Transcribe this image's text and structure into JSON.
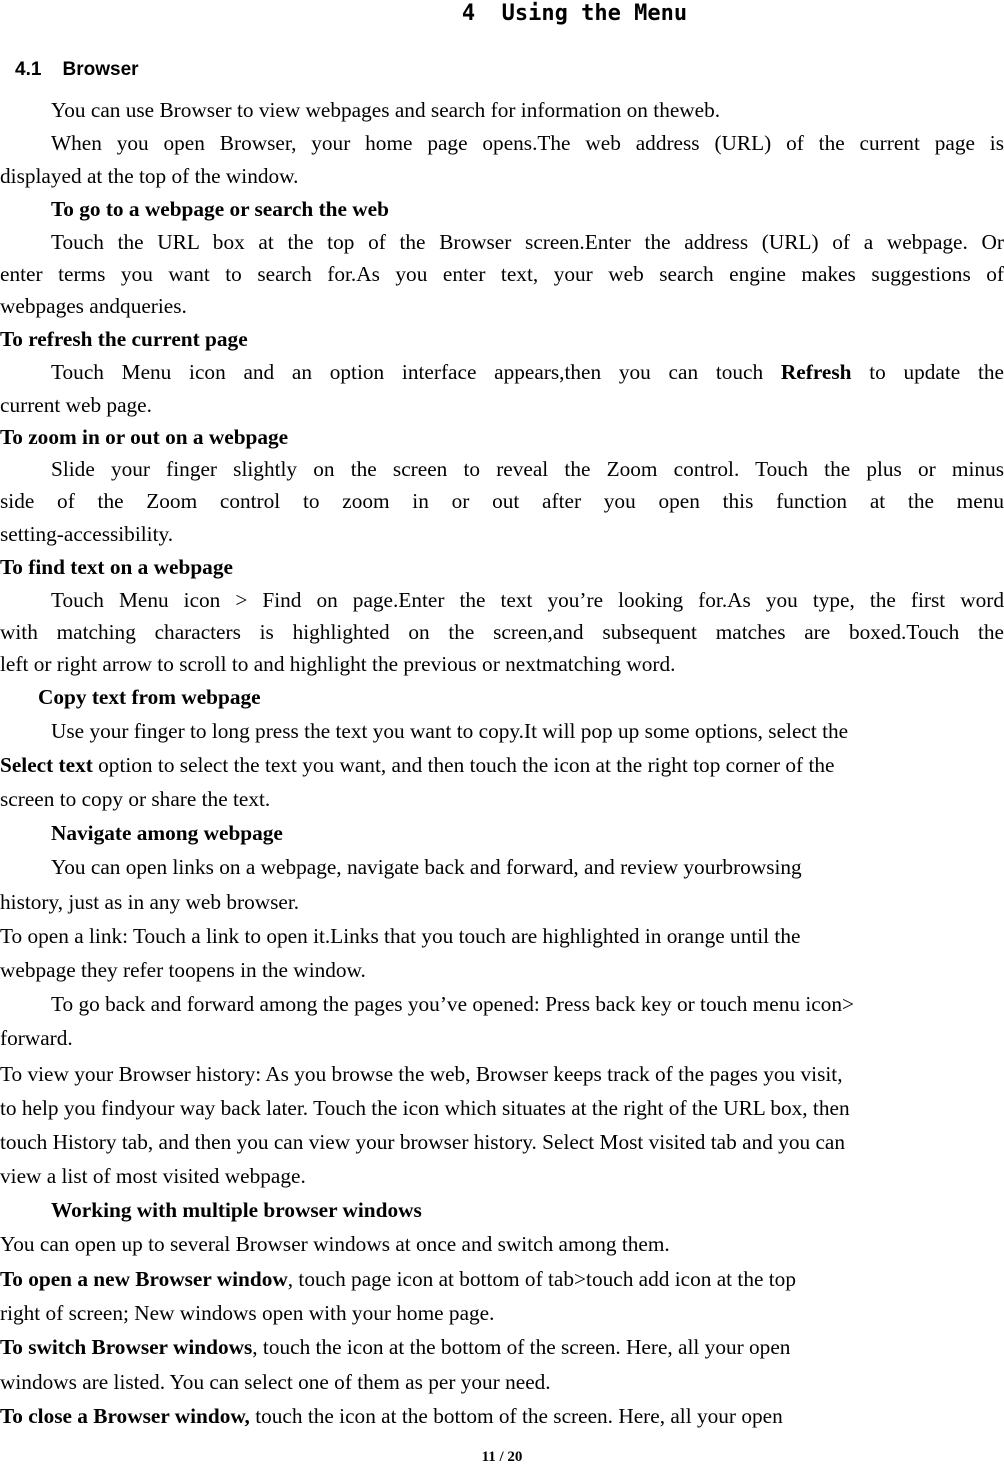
{
  "chapter": {
    "number": "4",
    "title": "Using the Menu"
  },
  "section": {
    "number": "4.1",
    "title": "Browser"
  },
  "lines": [
    {
      "parts": [
        {
          "t": "You can use Browser to view webpages and search for information on theweb."
        }
      ]
    },
    {
      "parts": [
        {
          "t": "When you open Browser, your home page opens.The web address (URL) of the current page is"
        }
      ]
    },
    {
      "parts": [
        {
          "t": "displayed at the top of the window."
        }
      ]
    },
    {
      "parts": [
        {
          "t": "To go to a webpage or search the web",
          "b": true
        }
      ]
    },
    {
      "parts": [
        {
          "t": "Touch the URL box at the top of the Browser screen.Enter the address (URL) of a webpage. Or"
        }
      ]
    },
    {
      "parts": [
        {
          "t": "enter terms you want to search for.As you enter text, your web search engine makes suggestions of"
        }
      ]
    },
    {
      "parts": [
        {
          "t": "webpages andqueries."
        }
      ]
    },
    {
      "parts": [
        {
          "t": "To refresh the current page",
          "b": true
        }
      ]
    },
    {
      "parts": [
        {
          "t": "Touch Menu icon and an option interface appears,then you can touch "
        },
        {
          "t": "Refresh",
          "b": true
        },
        {
          "t": " to update the"
        }
      ]
    },
    {
      "parts": [
        {
          "t": "current web page."
        }
      ]
    },
    {
      "parts": [
        {
          "t": "To zoom in or out on a webpage",
          "b": true
        }
      ]
    },
    {
      "parts": [
        {
          "t": "Slide your finger slightly on the screen to reveal the Zoom control. Touch the plus or minus"
        }
      ]
    },
    {
      "parts": [
        {
          "t": "side of the Zoom control to zoom in or out after you open this function at the menu"
        }
      ]
    },
    {
      "parts": [
        {
          "t": "setting-accessibility."
        }
      ]
    },
    {
      "parts": [
        {
          "t": "To find text on a webpage",
          "b": true
        }
      ]
    },
    {
      "parts": [
        {
          "t": "Touch Menu icon > Find on page.Enter the text you’re looking for.As you type, the first word"
        }
      ]
    },
    {
      "parts": [
        {
          "t": "with matching characters is highlighted on the screen,and subsequent matches are boxed.Touch the"
        }
      ]
    },
    {
      "parts": [
        {
          "t": "left or right arrow to scroll to and highlight the previous or nextmatching word."
        }
      ]
    },
    {
      "parts": [
        {
          "t": "Copy text from webpage",
          "b": true
        }
      ]
    },
    {
      "parts": [
        {
          "t": "Use your finger to long press the text you want to copy.It will pop up some options, select the"
        }
      ]
    },
    {
      "parts": [
        {
          "t": "Select text",
          "b": true
        },
        {
          "t": " option to select the text you want, and then touch the icon at the right top corner of the"
        }
      ]
    },
    {
      "parts": [
        {
          "t": "screen to copy or share the text."
        }
      ]
    },
    {
      "parts": [
        {
          "t": "Navigate among webpage",
          "b": true
        }
      ]
    },
    {
      "parts": [
        {
          "t": "You can open links on a webpage, navigate back and forward, and review yourbrowsing"
        }
      ]
    },
    {
      "parts": [
        {
          "t": "history, just as in any web browser."
        }
      ]
    },
    {
      "parts": [
        {
          "t": "To open a link: Touch a link to open it.Links that you touch are highlighted in orange until the"
        }
      ]
    },
    {
      "parts": [
        {
          "t": "webpage they refer toopens in the window."
        }
      ]
    },
    {
      "parts": [
        {
          "t": "To go back and forward among the pages you’ve opened: Press back key or touch menu icon>"
        }
      ]
    },
    {
      "parts": [
        {
          "t": "forward."
        }
      ]
    },
    {
      "parts": [
        {
          "t": "To view your Browser history: As you browse the web, Browser keeps track of the pages you visit,"
        }
      ]
    },
    {
      "parts": [
        {
          "t": "to help you findyour way back later. Touch the icon which situates at the right of the URL box, then"
        }
      ]
    },
    {
      "parts": [
        {
          "t": "touch History tab, and then you can view your browser history. Select Most visited tab and you can"
        }
      ]
    },
    {
      "parts": [
        {
          "t": "view a list of most visited webpage."
        }
      ]
    },
    {
      "parts": [
        {
          "t": "Working with multiple browser windows",
          "b": true
        }
      ]
    },
    {
      "parts": [
        {
          "t": "You can open up to several Browser windows at once and switch among them."
        }
      ]
    },
    {
      "parts": [
        {
          "t": "To open a new Browser window",
          "b": true
        },
        {
          "t": ", touch page icon at bottom of tab>touch add icon at the top"
        }
      ]
    },
    {
      "parts": [
        {
          "t": "right of screen; New windows open with your home page."
        }
      ]
    },
    {
      "parts": [
        {
          "t": "To switch Browser windows",
          "b": true
        },
        {
          "t": ", touch the icon at the bottom of the screen. Here, all your open"
        }
      ]
    },
    {
      "parts": [
        {
          "t": "windows are listed. You can select one of them as per your need."
        }
      ]
    },
    {
      "parts": [
        {
          "t": "To close a Browser window,",
          "b": true
        },
        {
          "t": " touch the icon at the bottom of the screen. Here, all your open"
        }
      ]
    }
  ],
  "footer": {
    "page_label": "11 / 20"
  }
}
